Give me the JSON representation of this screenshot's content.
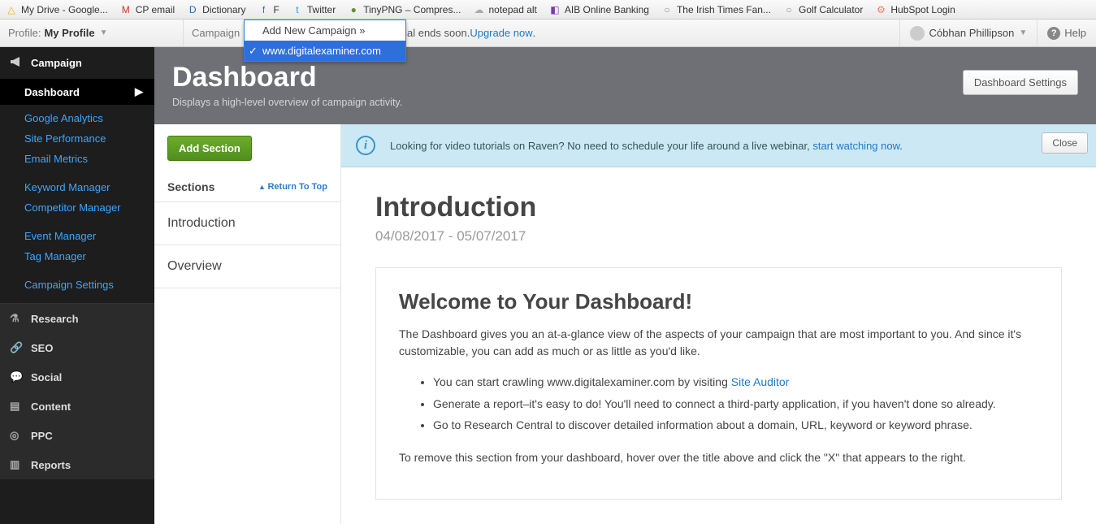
{
  "bookmarks": [
    {
      "label": "My Drive - Google...",
      "icon": "△",
      "color": "#f4b400"
    },
    {
      "label": "CP email",
      "icon": "M",
      "color": "#d93025"
    },
    {
      "label": "Dictionary",
      "icon": "D",
      "color": "#2b6cb0"
    },
    {
      "label": "F",
      "icon": "f",
      "color": "#1877f2"
    },
    {
      "label": "Twitter",
      "icon": "t",
      "color": "#1da1f2"
    },
    {
      "label": "TinyPNG – Compres...",
      "icon": "●",
      "color": "#5c913b"
    },
    {
      "label": "notepad alt",
      "icon": "☁",
      "color": "#aaa"
    },
    {
      "label": "AIB Online Banking",
      "icon": "◧",
      "color": "#7c3aac"
    },
    {
      "label": "The Irish Times Fan...",
      "icon": "○",
      "color": "#888"
    },
    {
      "label": "Golf Calculator",
      "icon": "○",
      "color": "#888"
    },
    {
      "label": "HubSpot Login",
      "icon": "⚙",
      "color": "#ff7a59"
    }
  ],
  "toolbar": {
    "profile_label": "Profile:",
    "profile_value": "My Profile",
    "campaign_label": "Campaign",
    "trial_text": "Your free trial ends soon. ",
    "trial_link": "Upgrade now",
    "user_name": "Cóbhan Phillipson",
    "help": "Help"
  },
  "campaign_menu": {
    "add": "Add New Campaign »",
    "selected": "www.digitalexaminer.com"
  },
  "sidebar": {
    "campaign": "Campaign",
    "dashboard": "Dashboard",
    "links_a": [
      "Google Analytics",
      "Site Performance",
      "Email Metrics"
    ],
    "links_b": [
      "Keyword Manager",
      "Competitor Manager"
    ],
    "links_c": [
      "Event Manager",
      "Tag Manager"
    ],
    "links_d": [
      "Campaign Settings"
    ],
    "collapsed": [
      "Research",
      "SEO",
      "Social",
      "Content",
      "PPC",
      "Reports"
    ],
    "icons": [
      "⚗",
      "🔗",
      "💬",
      "▤",
      "◎",
      "▥"
    ]
  },
  "header": {
    "title": "Dashboard",
    "subtitle": "Displays a high-level overview of campaign activity.",
    "settings_btn": "Dashboard Settings"
  },
  "sections": {
    "add_btn": "Add Section",
    "title": "Sections",
    "return": "Return To Top",
    "items": [
      "Introduction",
      "Overview"
    ]
  },
  "notice": {
    "text": "Looking for video tutorials on Raven? No need to schedule your life around a live webinar, ",
    "link": "start watching now",
    "close": "Close"
  },
  "article": {
    "h2": "Introduction",
    "range": "04/08/2017 - 05/07/2017",
    "welcome_h": "Welcome to Your Dashboard!",
    "p1": "The Dashboard gives you an at-a-glance view of the aspects of your campaign that are most important to you. And since it's customizable, you can add as much or as little as you'd like.",
    "li1a": "You can start crawling www.digitalexaminer.com by visiting ",
    "li1b": "Site Auditor",
    "li2": "Generate a report–it's easy to do! You'll need to connect a third-party application, if you haven't done so already.",
    "li3": "Go to Research Central to discover detailed information about a domain, URL, keyword or keyword phrase.",
    "p2": "To remove this section from your dashboard, hover over the title above and click the \"X\" that appears to the right."
  }
}
